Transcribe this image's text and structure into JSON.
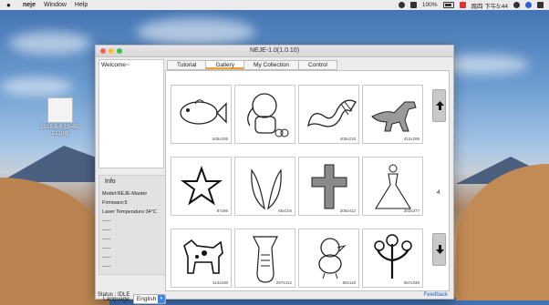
{
  "menubar": {
    "app_name": "neje",
    "items": [
      "Window",
      "Help"
    ],
    "battery": "100%",
    "clock": "周四 下午5:44"
  },
  "desktop_file": {
    "name": "2018-6-6 18-45-21.png"
  },
  "window": {
    "title": "NEJE-1.0(1.0.10)",
    "welcome": "Welcome~",
    "info": {
      "title": "Info",
      "model": "Model:NEJE-Master",
      "firmware": "Firmware:5",
      "laser_temp": "Laser Temperature:34°C",
      "placeholders": [
        "-----",
        "-----",
        "-----",
        "-----",
        "-----",
        "-----"
      ]
    },
    "language": {
      "label": "Language",
      "value": "English"
    },
    "tabs": [
      {
        "label": "Tutorial",
        "active": false
      },
      {
        "label": "Gallery",
        "active": true
      },
      {
        "label": "My Collection",
        "active": false
      },
      {
        "label": "Control",
        "active": false
      }
    ],
    "gallery": [
      {
        "icon": "fish-icon",
        "dim": "548x195"
      },
      {
        "icon": "elephant-icon",
        "dim": ""
      },
      {
        "icon": "swirl-icon",
        "dim": "405x218"
      },
      {
        "icon": "dinosaur-icon",
        "dim": "412x269"
      },
      {
        "icon": "star-icon",
        "dim": "87x86"
      },
      {
        "icon": "wings-icon",
        "dim": "60x104"
      },
      {
        "icon": "cross-icon",
        "dim": "305x412"
      },
      {
        "icon": "dress-icon",
        "dim": "302x377"
      },
      {
        "icon": "dog-icon",
        "dim": "114x100"
      },
      {
        "icon": "tuba-icon",
        "dim": "297x412"
      },
      {
        "icon": "chick-icon",
        "dim": "88x118"
      },
      {
        "icon": "tree-icon",
        "dim": "367x348"
      }
    ],
    "page_number": "4",
    "status": "Status : IDLE",
    "feedback": "Feedback"
  }
}
